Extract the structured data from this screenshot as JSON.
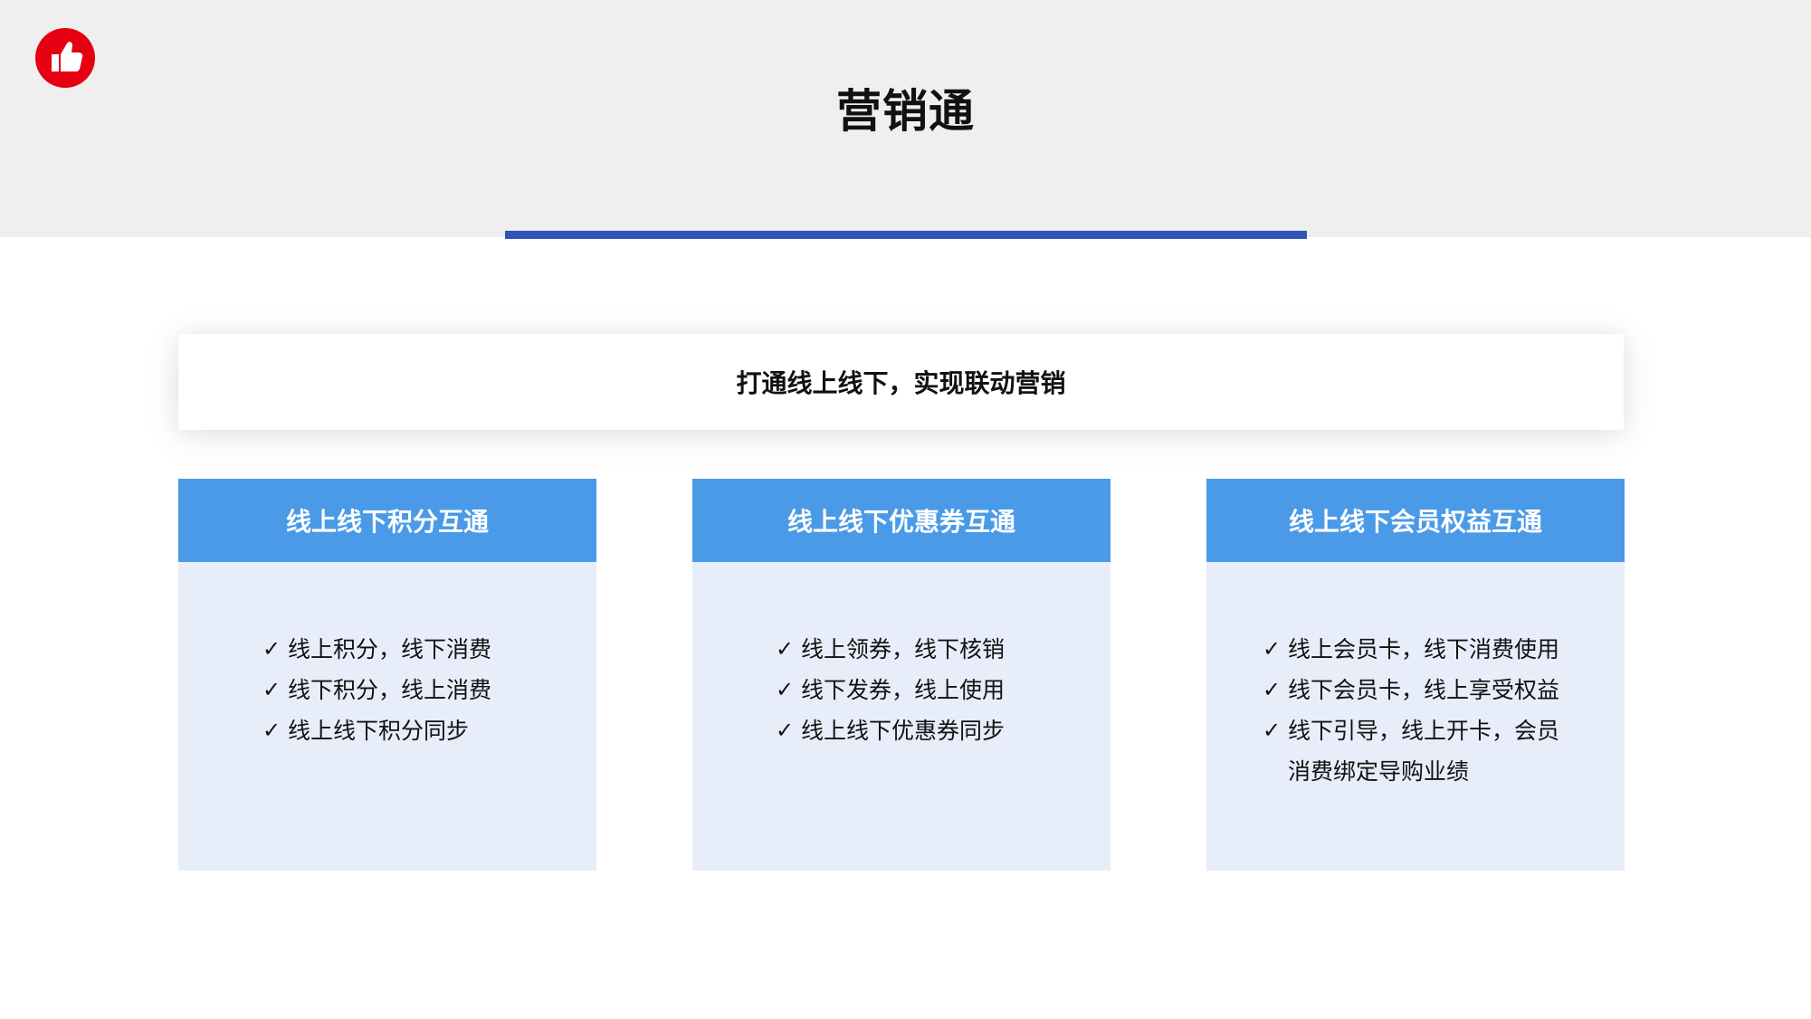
{
  "page": {
    "title": "营销通",
    "subtitle": "打通线上线下，实现联动营销"
  },
  "logo": {
    "icon": "thumbs-up-icon",
    "color": "#e60012"
  },
  "colors": {
    "header_band": "#efefef",
    "underline": "#2d55b4",
    "card_header": "#4a9ae8",
    "card_body": "#e8edfa"
  },
  "cards": [
    {
      "title": "线上线下积分互通",
      "items": [
        "线上积分，线下消费",
        "线下积分，线上消费",
        "线上线下积分同步"
      ]
    },
    {
      "title": "线上线下优惠券互通",
      "items": [
        "线上领券，线下核销",
        "线下发券，线上使用",
        "线上线下优惠券同步"
      ]
    },
    {
      "title": "线上线下会员权益互通",
      "items": [
        "线上会员卡，线下消费使用",
        "线下会员卡，线上享受权益",
        "线下引导，线上开卡，会员消费绑定导购业绩"
      ]
    }
  ],
  "check_mark": "✓"
}
